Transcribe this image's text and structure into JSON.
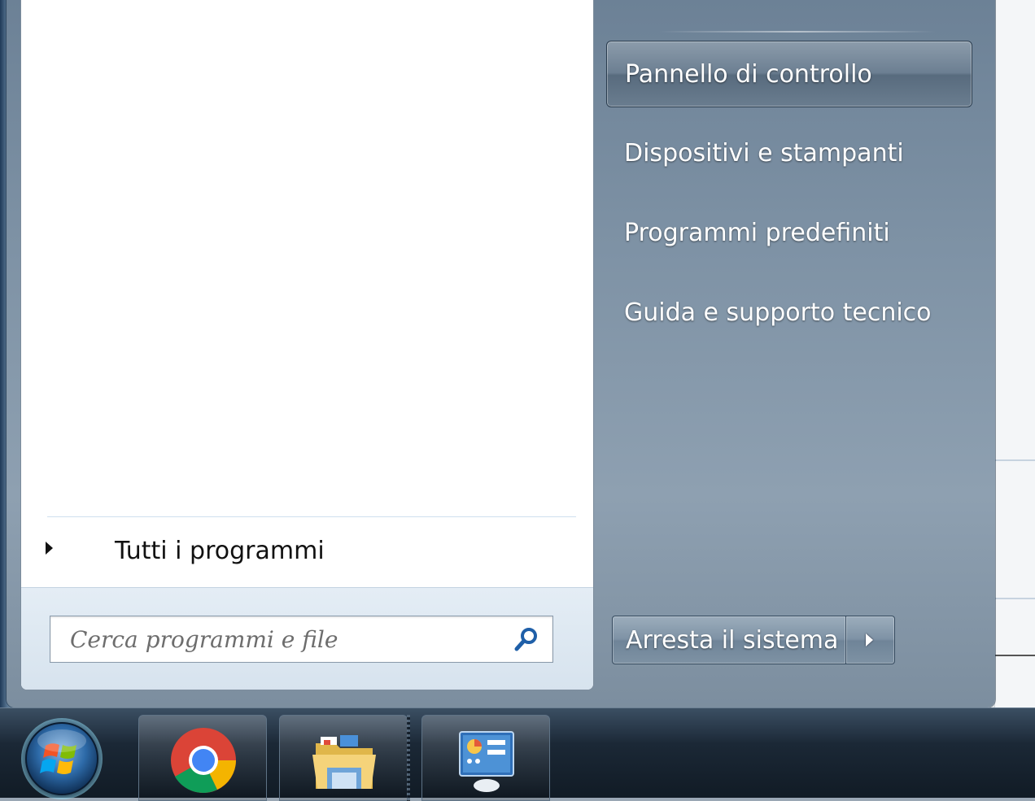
{
  "start_menu": {
    "right_items": [
      {
        "label": "Pannello di controllo",
        "selected": true
      },
      {
        "label": "Dispositivi e stampanti"
      },
      {
        "label": "Programmi predefiniti"
      },
      {
        "label": "Guida e supporto tecnico"
      }
    ],
    "all_programs_label": "Tutti i programmi",
    "search": {
      "placeholder": "Cerca programmi e file",
      "value": ""
    },
    "shutdown_label": "Arresta il sistema"
  },
  "taskbar": {
    "pinned": [
      {
        "icon": "chrome-icon"
      },
      {
        "icon": "file-explorer-icon"
      },
      {
        "icon": "control-panel-icon"
      }
    ]
  },
  "colors": {
    "accent": "#6c8196",
    "taskbar": "#1b2836",
    "chrome_red": "#db4437",
    "chrome_yellow": "#f4b400",
    "chrome_green": "#0f9d58",
    "chrome_blue": "#4285f4"
  }
}
